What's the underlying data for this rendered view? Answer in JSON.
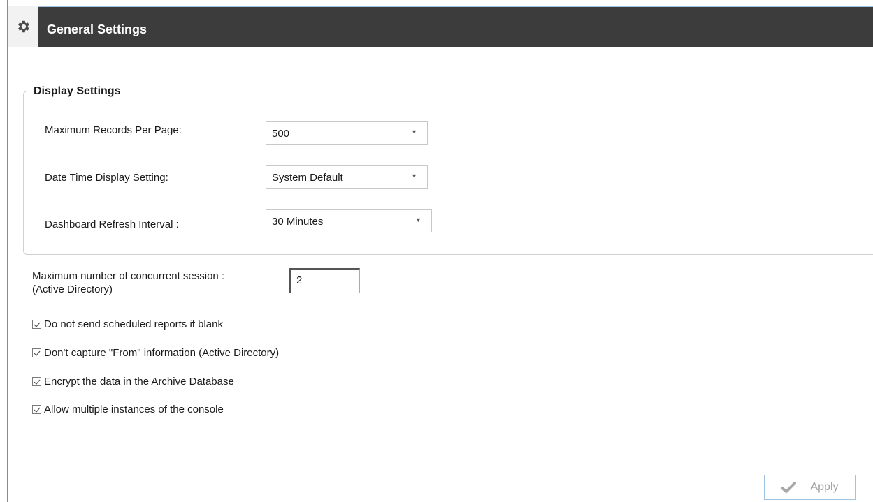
{
  "header": {
    "title": "General Settings",
    "icon": "gear-icon"
  },
  "display_settings": {
    "legend": "Display Settings",
    "max_records": {
      "label": "Maximum Records Per Page:",
      "value": "500"
    },
    "date_time": {
      "label": "Date Time Display Setting:",
      "value": "System Default"
    },
    "refresh": {
      "label": "Dashboard Refresh Interval :",
      "value": "30 Minutes"
    }
  },
  "concurrent": {
    "label_line1": "Maximum number of concurrent session :",
    "label_line2": "(Active Directory)",
    "value": "2"
  },
  "checkboxes": [
    {
      "label": "Do not send scheduled reports if blank",
      "checked": true
    },
    {
      "label": "Don't capture \"From\" information (Active Directory)",
      "checked": true
    },
    {
      "label": "Encrypt the data in the Archive Database",
      "checked": true
    },
    {
      "label": "Allow multiple instances of the console",
      "checked": true
    }
  ],
  "footer": {
    "apply_label": "Apply"
  }
}
